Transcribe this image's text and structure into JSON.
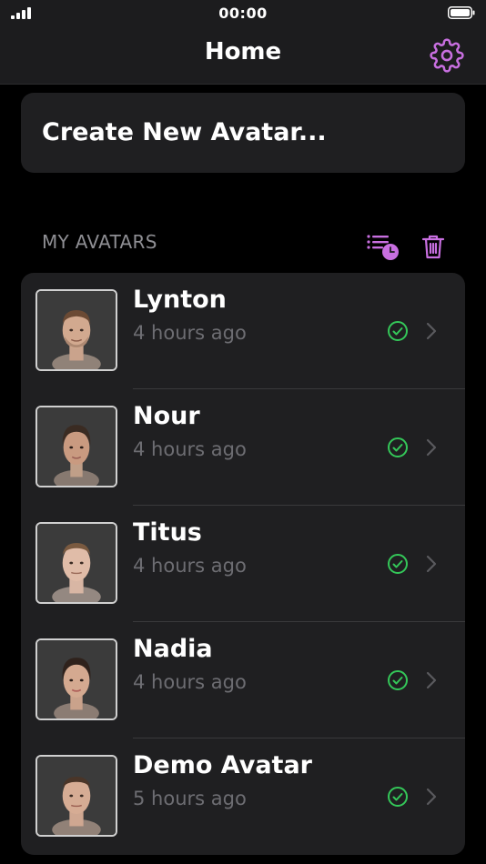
{
  "status_bar": {
    "time": "00:00"
  },
  "nav": {
    "title": "Home",
    "settings_icon": "gear-icon"
  },
  "create": {
    "label": "Create New Avatar..."
  },
  "section": {
    "header": "MY AVATARS",
    "sort_icon": "sort-recent-icon",
    "delete_icon": "trash-icon"
  },
  "colors": {
    "accent": "#c86fe0",
    "success": "#34c759",
    "card": "#1f1f21",
    "secondary_text": "#6d6d72"
  },
  "avatars": [
    {
      "name": "Lynton",
      "time": "4 hours ago",
      "status": "ready"
    },
    {
      "name": "Nour",
      "time": "4 hours ago",
      "status": "ready"
    },
    {
      "name": "Titus",
      "time": "4 hours ago",
      "status": "ready"
    },
    {
      "name": "Nadia",
      "time": "4 hours ago",
      "status": "ready"
    },
    {
      "name": "Demo Avatar",
      "time": "5 hours ago",
      "status": "ready"
    }
  ]
}
